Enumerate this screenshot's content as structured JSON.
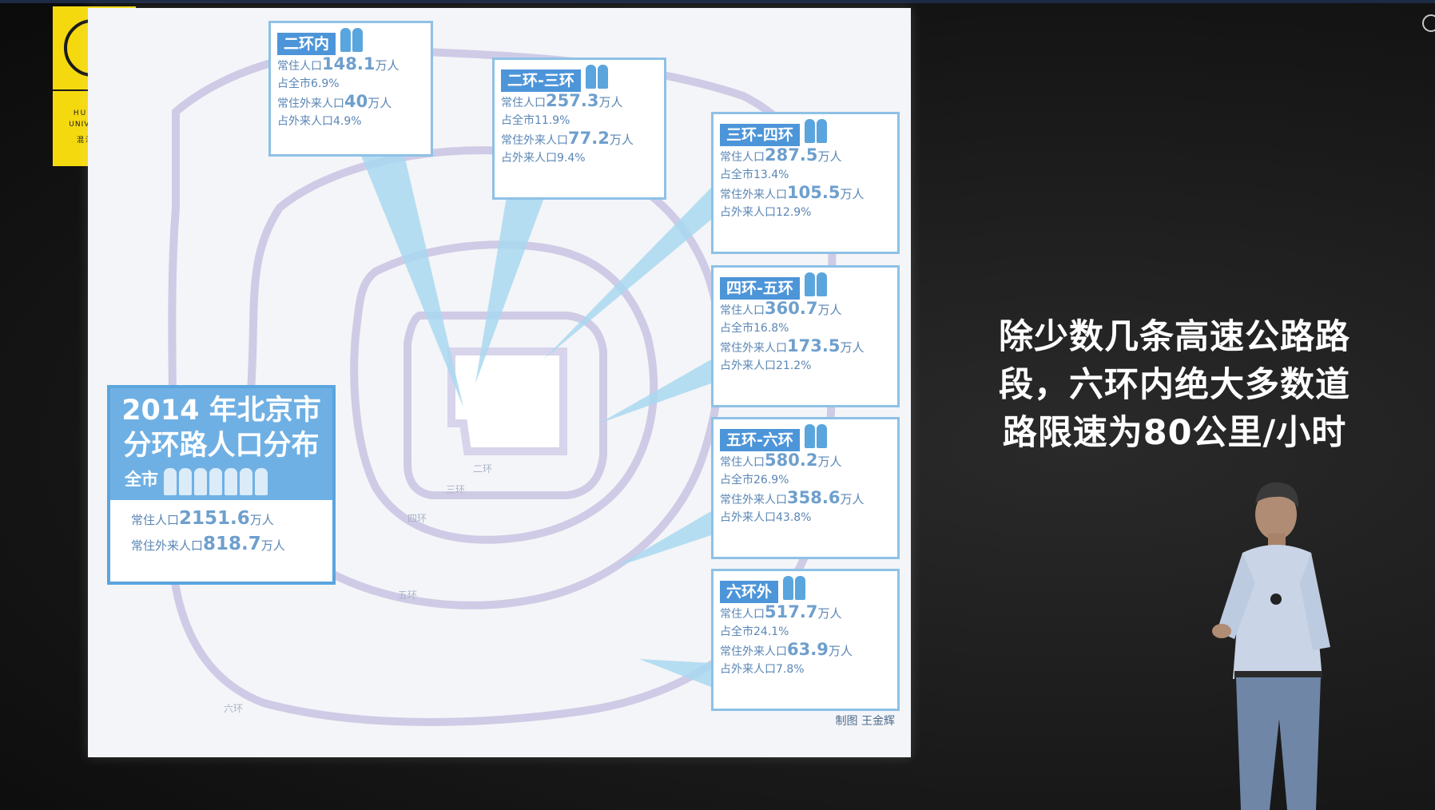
{
  "logo": {
    "name_line1": "HUNDUN",
    "name_line2": "UNIVERSITY",
    "cn": "混沌大学"
  },
  "caption": [
    "除少数几条高速公路路",
    "段，六环内绝大多数道",
    "路限速为80公里/小时"
  ],
  "summary": {
    "title_line1": "2014 年北京市",
    "title_line2": "分环路人口分布",
    "scope": "全市",
    "resident_label": "常住人口",
    "resident_value": "2151.6",
    "resident_unit": "万人",
    "migrant_label": "常住外来人口",
    "migrant_value": "818.7",
    "migrant_unit": "万人"
  },
  "zones": [
    {
      "title": "二环内",
      "r_label": "常住人口",
      "r_value": "148.1",
      "unit": "万人",
      "share_city": "占全市6.9%",
      "m_label": "常住外来人口",
      "m_value": "40",
      "share_migrant": "占外来人口4.9%"
    },
    {
      "title": "二环-三环",
      "r_label": "常住人口",
      "r_value": "257.3",
      "unit": "万人",
      "share_city": "占全市11.9%",
      "m_label": "常住外来人口",
      "m_value": "77.2",
      "share_migrant": "占外来人口9.4%"
    },
    {
      "title": "三环-四环",
      "r_label": "常住人口",
      "r_value": "287.5",
      "unit": "万人",
      "share_city": "占全市13.4%",
      "m_label": "常住外来人口",
      "m_value": "105.5",
      "share_migrant": "占外来人口12.9%"
    },
    {
      "title": "四环-五环",
      "r_label": "常住人口",
      "r_value": "360.7",
      "unit": "万人",
      "share_city": "占全市16.8%",
      "m_label": "常住外来人口",
      "m_value": "173.5",
      "share_migrant": "占外来人口21.2%"
    },
    {
      "title": "五环-六环",
      "r_label": "常住人口",
      "r_value": "580.2",
      "unit": "万人",
      "share_city": "占全市26.9%",
      "m_label": "常住外来人口",
      "m_value": "358.6",
      "share_migrant": "占外来人口43.8%"
    },
    {
      "title": "六环外",
      "r_label": "常住人口",
      "r_value": "517.7",
      "unit": "万人",
      "share_city": "占全市24.1%",
      "m_label": "常住外来人口",
      "m_value": "63.9",
      "share_migrant": "占外来人口7.8%"
    }
  ],
  "ring_labels": [
    "二环",
    "三环",
    "四环",
    "五环",
    "六环"
  ],
  "credit": "制图 王金辉",
  "colors": {
    "accent_blue": "#4d95d9",
    "logo_yellow": "#f5d90f",
    "ring_purple": "#c9c6e4"
  }
}
